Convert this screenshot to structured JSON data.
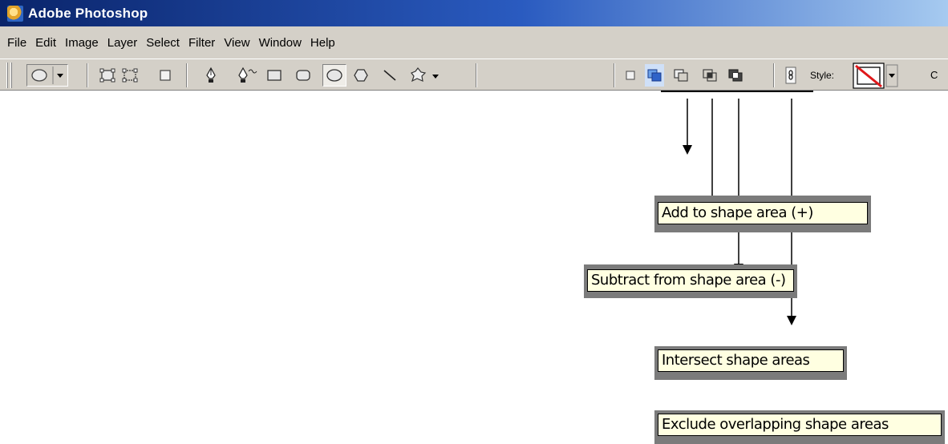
{
  "window": {
    "title": "Adobe Photoshop",
    "icon": "photoshop-app-icon"
  },
  "menubar": {
    "items": [
      "File",
      "Edit",
      "Image",
      "Layer",
      "Select",
      "Filter",
      "View",
      "Window",
      "Help"
    ]
  },
  "options_bar": {
    "tool_preset_icon": "ellipse-preset-icon",
    "mode_icons": [
      "shape-layers-icon",
      "paths-icon",
      "fill-pixels-icon"
    ],
    "drawing_tools": [
      "pen-icon",
      "freeform-pen-icon",
      "rectangle-icon",
      "rounded-rectangle-icon",
      "ellipse-icon",
      "polygon-icon",
      "line-icon",
      "custom-shape-icon"
    ],
    "shape_area_modes": [
      "create-new-shape-layer-icon",
      "add-to-shape-area-icon",
      "subtract-from-shape-area-icon",
      "intersect-shape-areas-icon",
      "exclude-overlapping-shape-areas-icon"
    ],
    "link_icon": "link-layer-style-icon",
    "style_label": "Style:",
    "trailing_text": "C"
  },
  "callouts": {
    "add": "Add to shape area (+)",
    "subtract": "Subtract from shape area (-)",
    "intersect": "Intersect shape areas",
    "exclude": "Exclude overlapping shape areas"
  },
  "colors": {
    "title_gradient_start": "#0a246a",
    "title_gradient_end": "#a6caf0",
    "chrome": "#d4d0c8",
    "tooltip_bg": "#ffffe1"
  }
}
